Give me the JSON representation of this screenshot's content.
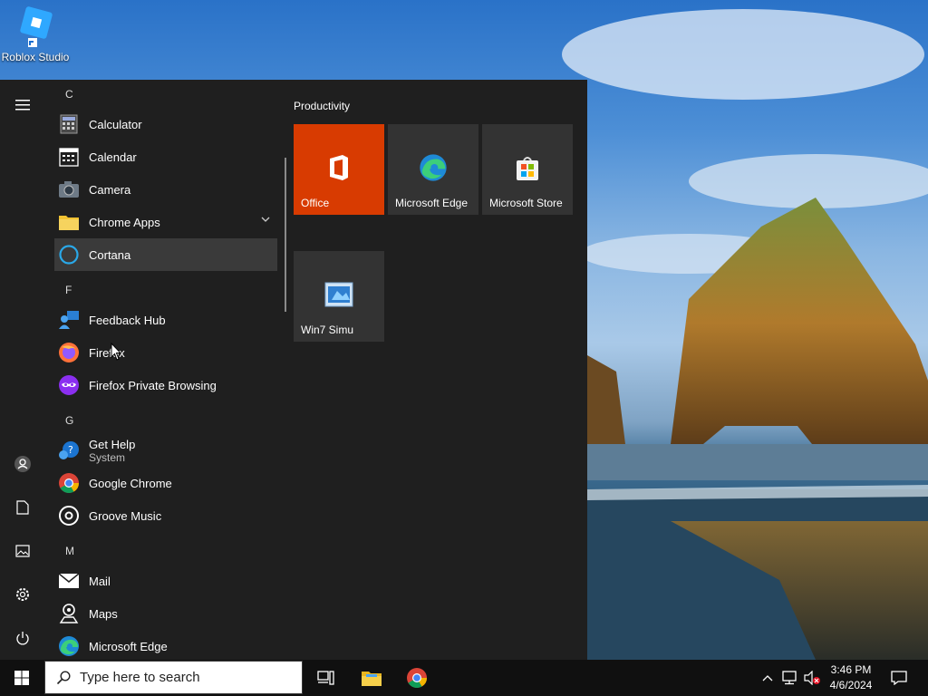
{
  "desktop": {
    "icons": [
      {
        "label": "Roblox Studio",
        "icon": "roblox-studio-icon"
      }
    ]
  },
  "start_menu": {
    "rail": [
      "hamburger-menu-icon",
      "user-icon",
      "documents-icon",
      "pictures-icon",
      "settings-icon",
      "power-icon"
    ],
    "app_list": {
      "letters": {
        "c": "C",
        "f": "F",
        "g": "G",
        "m": "M"
      },
      "items": [
        {
          "label": "Calculator",
          "icon": "calculator-icon"
        },
        {
          "label": "Calendar",
          "icon": "calendar-icon"
        },
        {
          "label": "Camera",
          "icon": "camera-icon"
        },
        {
          "label": "Chrome Apps",
          "icon": "folder-icon",
          "expandable": true
        },
        {
          "label": "Cortana",
          "icon": "cortana-icon",
          "selected": true
        },
        {
          "label": "Feedback Hub",
          "icon": "feedback-hub-icon"
        },
        {
          "label": "Firefox",
          "icon": "firefox-icon"
        },
        {
          "label": "Firefox Private Browsing",
          "icon": "firefox-private-icon"
        },
        {
          "label": "Get Help",
          "sublabel": "System",
          "icon": "get-help-icon"
        },
        {
          "label": "Google Chrome",
          "icon": "chrome-icon"
        },
        {
          "label": "Groove Music",
          "icon": "groove-music-icon"
        },
        {
          "label": "Mail",
          "icon": "mail-icon"
        },
        {
          "label": "Maps",
          "icon": "maps-icon"
        },
        {
          "label": "Microsoft Edge",
          "icon": "edge-icon"
        }
      ]
    },
    "tiles": {
      "group_title": "Productivity",
      "items": [
        {
          "label": "Office",
          "icon": "office-icon",
          "color": "#d83b01"
        },
        {
          "label": "Microsoft Edge",
          "icon": "edge-icon",
          "color": "#333333"
        },
        {
          "label": "Microsoft Store",
          "icon": "store-icon",
          "color": "#333333"
        },
        {
          "label": "Win7 Simu",
          "icon": "win7-simu-icon",
          "color": "#333333"
        }
      ]
    }
  },
  "taskbar": {
    "search_placeholder": "Type here to search",
    "pinned": [
      "task-view-icon",
      "file-explorer-icon",
      "chrome-icon"
    ],
    "tray_icons": [
      "chevron-up-icon",
      "network-icon",
      "volume-muted-icon"
    ],
    "time": "3:46 PM",
    "date": "4/6/2024",
    "notification_icon": "action-center-icon"
  },
  "colors": {
    "accent": "#d83b01",
    "start_bg": "#1f1f1f",
    "taskbar_bg": "#101010",
    "tile_bg": "#333333"
  }
}
